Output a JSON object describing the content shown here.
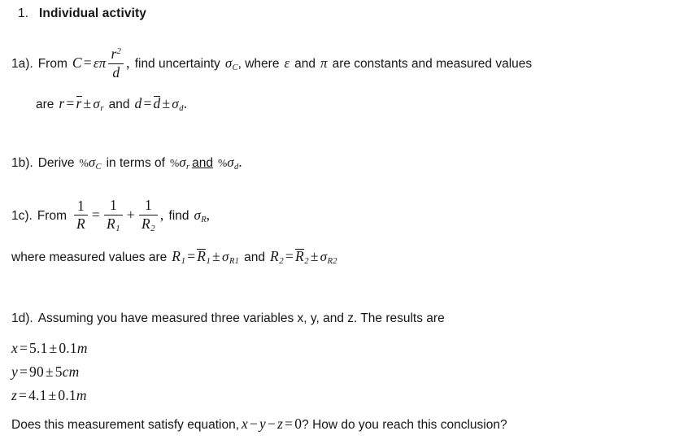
{
  "document": {
    "heading": {
      "number": "1.",
      "title": "Individual activity"
    },
    "items": [
      {
        "id": "1a",
        "label": "1a).",
        "text_before": "From",
        "equation_lhs": "C",
        "equation_eq": "=",
        "equation_const1": "ε",
        "equation_const2": "π",
        "fraction_numerator": "r",
        "fraction_numerator_exponent": "2",
        "fraction_denominator": "d",
        "comma": ",",
        "text_find": "find uncertainty",
        "sigma": "σ",
        "sigma_sub": "C",
        "text_after": ", where",
        "const_epsilon": "ε",
        "text_and": "and",
        "const_pi": "π",
        "text_tail": "are constants and measured values",
        "continuation": {
          "text_are": "are",
          "r_lhs": "r",
          "eq1": "=",
          "r_mean": "r",
          "pm1": "±",
          "sigma_r": "σ",
          "sigma_r_sub": "r",
          "text_and": "and",
          "d_lhs": "d",
          "eq2": "=",
          "d_mean": "d",
          "pm2": "±",
          "sigma_d": "σ",
          "sigma_d_sub": "d",
          "period": "."
        }
      },
      {
        "id": "1b",
        "label": "1b).",
        "text_derive": "Derive",
        "pct1": "%",
        "sigma1": "σ",
        "sigma1_sub": "C",
        "text_in_terms_of": "in terms of",
        "pct2": "%",
        "sigma2": "σ",
        "sigma2_sub": "r",
        "text_and_underlined": "and",
        "pct3": "%",
        "sigma3": "σ",
        "sigma3_sub": "d",
        "period": "."
      },
      {
        "id": "1c",
        "label": "1c).",
        "text_from": "From",
        "f1_num": "1",
        "f1_den": "R",
        "eq": "=",
        "f2_num": "1",
        "f2_den": "R",
        "f2_den_sub": "1",
        "plus": "+",
        "f3_num": "1",
        "f3_den": "R",
        "f3_den_sub": "2",
        "comma": ",",
        "text_find": "find",
        "sigma": "σ",
        "sigma_sub": "R",
        "trailing_comma": ",",
        "where_line": {
          "text_where": "where measured values are",
          "R1": "R",
          "R1_sub": "1",
          "eq1": "=",
          "R1_mean": "R",
          "R1_mean_sub": "1",
          "pm1": "±",
          "sigma_R1": "σ",
          "sigma_R1_sub": "R1",
          "text_and": "and",
          "R2": "R",
          "R2_sub": "2",
          "eq2": "=",
          "R2_mean": "R",
          "R2_mean_sub": "2",
          "pm2": "±",
          "sigma_R2": "σ",
          "sigma_R2_sub": "R2"
        }
      },
      {
        "id": "1d",
        "label": "1d).",
        "text": "Assuming you have measured three variables x, y, and z. The results are",
        "measurements": [
          {
            "var": "x",
            "eq": "=",
            "value": "5.1",
            "pm": "±",
            "uncertainty": "0.1",
            "unit": "m"
          },
          {
            "var": "y",
            "eq": "=",
            "value": "90",
            "pm": "±",
            "uncertainty": "5",
            "unit": "cm"
          },
          {
            "var": "z",
            "eq": "=",
            "value": "4.1",
            "pm": "±",
            "uncertainty": "0.1",
            "unit": "m"
          }
        ],
        "final_question": {
          "text_before": "Does this measurement satisfy equation,",
          "eq_x": "x",
          "minus1": "−",
          "eq_y": "y",
          "minus2": "−",
          "eq_z": "z",
          "equals": "=",
          "zero": "0",
          "text_after": "? How do you reach this conclusion?"
        }
      }
    ]
  },
  "colors": {
    "background": "#ffffff",
    "text": "#161616"
  }
}
